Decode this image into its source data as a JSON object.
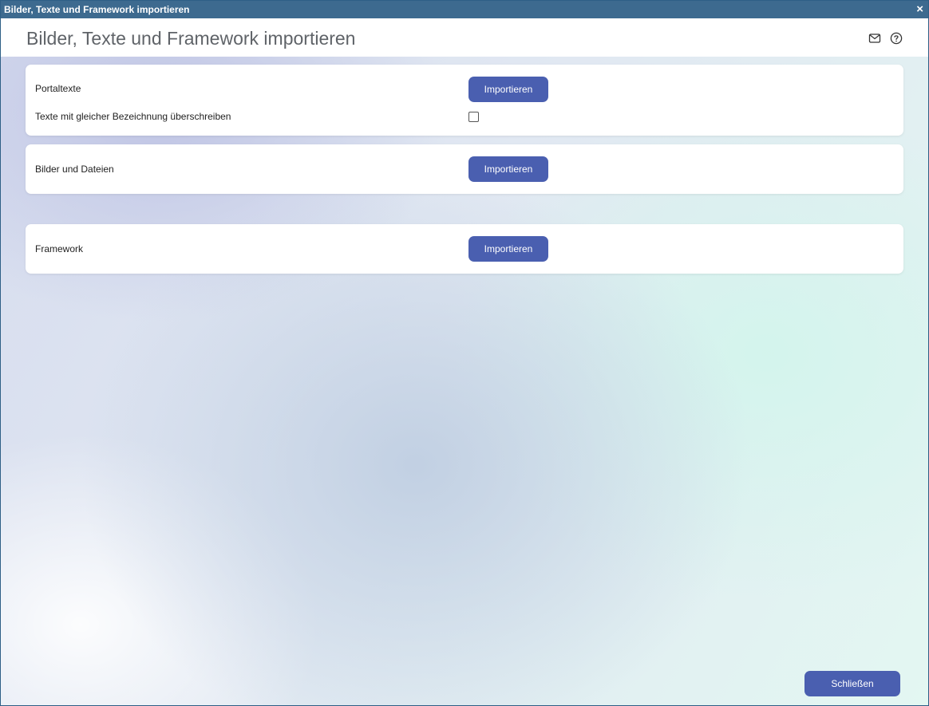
{
  "window": {
    "title": "Bilder, Texte und Framework importieren",
    "close_glyph": "×"
  },
  "header": {
    "title": "Bilder, Texte und Framework importieren",
    "icons": [
      "mail-icon",
      "help-icon"
    ]
  },
  "sections": [
    {
      "label": "Portaltexte",
      "button_label": "Importieren",
      "option_label": "Texte mit gleicher Bezeichnung überschreiben",
      "option_checked": false
    },
    {
      "label": "Bilder und Dateien",
      "button_label": "Importieren"
    },
    {
      "label": "Framework",
      "button_label": "Importieren"
    }
  ],
  "footer": {
    "close_label": "Schließen"
  },
  "colors": {
    "titlebar": "#3d6a8f",
    "accent": "#4a5fb0"
  }
}
